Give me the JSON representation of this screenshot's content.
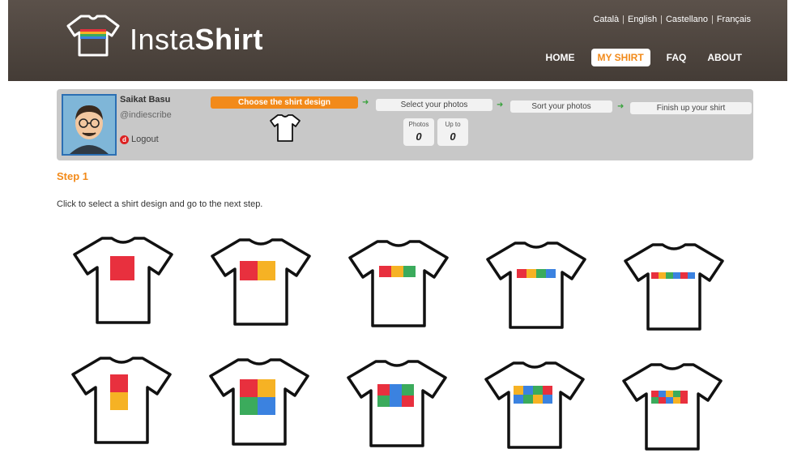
{
  "header": {
    "logo_plain": "Insta",
    "logo_bold": "Shirt",
    "languages": [
      "Català",
      "English",
      "Castellano",
      "Français"
    ],
    "nav": [
      {
        "label": "HOME",
        "active": false
      },
      {
        "label": "MY SHIRT",
        "active": true
      },
      {
        "label": "FAQ",
        "active": false
      },
      {
        "label": "ABOUT",
        "active": false
      }
    ]
  },
  "user": {
    "name": "Saikat Basu",
    "handle": "@indiescribe",
    "logout_label": "Logout"
  },
  "wizard": {
    "steps": [
      {
        "label": "Choose the shirt design",
        "active": true
      },
      {
        "label": "Select your photos",
        "active": false
      },
      {
        "label": "Sort your photos",
        "active": false
      },
      {
        "label": "Finish up your shirt",
        "active": false
      }
    ],
    "counters": [
      {
        "label": "Photos",
        "value": "0"
      },
      {
        "label": "Up to",
        "value": "0"
      }
    ]
  },
  "content": {
    "step_title": "Step 1",
    "step_desc": "Click to select a shirt design and go to the next step."
  },
  "colors": {
    "accent": "#f28a1a",
    "red": "#e8303e",
    "yellow": "#f6b224",
    "green": "#3bab5c",
    "blue": "#3b82e0"
  },
  "designs": [
    {
      "pattern": "1 photo"
    },
    {
      "pattern": "2 photos in a row"
    },
    {
      "pattern": "3 photos in a row"
    },
    {
      "pattern": "4 photos in a row"
    },
    {
      "pattern": "6 photos in a row"
    },
    {
      "pattern": "2 photos stacked"
    },
    {
      "pattern": "2x2 grid"
    },
    {
      "pattern": "3x2 grid"
    },
    {
      "pattern": "4x2 grid"
    },
    {
      "pattern": "5x2 grid"
    }
  ]
}
